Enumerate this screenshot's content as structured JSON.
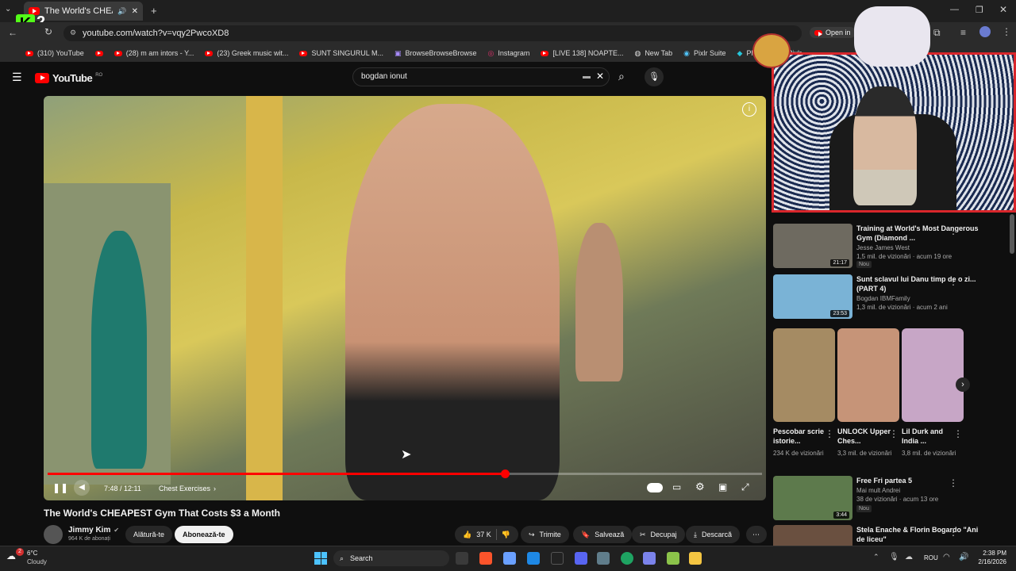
{
  "browser": {
    "tab_title": "The World's CHEAPEST Gym That",
    "url": "youtube.com/watch?v=vqy2PwcoXD8",
    "open_in_label": "Open in",
    "bookmarks": [
      "(310) YouTube",
      "(28) m am intors - Y...",
      "(23) Greek music wit...",
      "SUNT SINGURUL M...",
      "BrowseBrowseBrowse",
      "Instagram",
      "[LIVE 138] NOAPTE...",
      "New Tab",
      "Pixlr Suite",
      "Photo Editor Pixlr"
    ]
  },
  "overlay": {
    "channel_badge": "2"
  },
  "header": {
    "logo_text": "YouTube",
    "logo_badge": "RO",
    "search_value": "bogdan ionut"
  },
  "player": {
    "progress": 0.6398,
    "time": "7:48 / 12:11",
    "chapter": "Chest Exercises"
  },
  "video": {
    "title": "The World's CHEAPEST Gym That Costs $3 a Month",
    "channel": "Jimmy Kim",
    "subscribers": "964 K de abonați",
    "join_label": "Alătură-te",
    "subscribe_label": "Abonează-te",
    "likes": "37 K",
    "share_label": "Trimite",
    "save_label": "Salvează",
    "clip_label": "Decupaj",
    "download_label": "Descarcă"
  },
  "recommendations": [
    {
      "title": "Training at World's Most Dangerous Gym (Diamond ...",
      "channel": "Jesse James West",
      "meta": "1,5 mil. de vizionări · acum 19 ore",
      "duration": "21:17",
      "badge": "Nou",
      "color": "#6e6a60"
    },
    {
      "title": "Sunt sclavul lui Danu timp de o zi... (PART 4)",
      "channel": "Bogdan IBMFamily",
      "meta": "1,3 mil. de vizionări · acum 2 ani",
      "duration": "23:53",
      "badge": "",
      "color": "#7ab3d6"
    }
  ],
  "shorts": [
    {
      "title": "Pescobar scrie istorie...",
      "views": "234 K de vizionări",
      "color": "#a58b63"
    },
    {
      "title": "UNLOCK Upper Ches...",
      "views": "3,3 mil. de vizionări",
      "color": "#c69478"
    },
    {
      "title": "Lil Durk and India ...",
      "views": "3,8 mil. de vizionări",
      "color": "#c7a6c6"
    }
  ],
  "recommendations2": [
    {
      "title": "Free Fri partea 5",
      "channel": "Mai mult Andrei",
      "meta": "38 de vizionări · acum 13 ore",
      "duration": "3:44",
      "badge": "Nou",
      "color": "#5d7a4c"
    },
    {
      "title": "Stela Enache & Florin Bogardo \"Ani de liceu\"",
      "channel": "",
      "meta": "",
      "duration": "",
      "badge": "",
      "color": "#6a5040"
    }
  ],
  "taskbar": {
    "weather_temp": "6°C",
    "weather_desc": "Cloudy",
    "weather_badge": "2",
    "search_label": "Search",
    "lang": "ROU",
    "time": "2:38 PM",
    "date": "2/16/2026"
  }
}
